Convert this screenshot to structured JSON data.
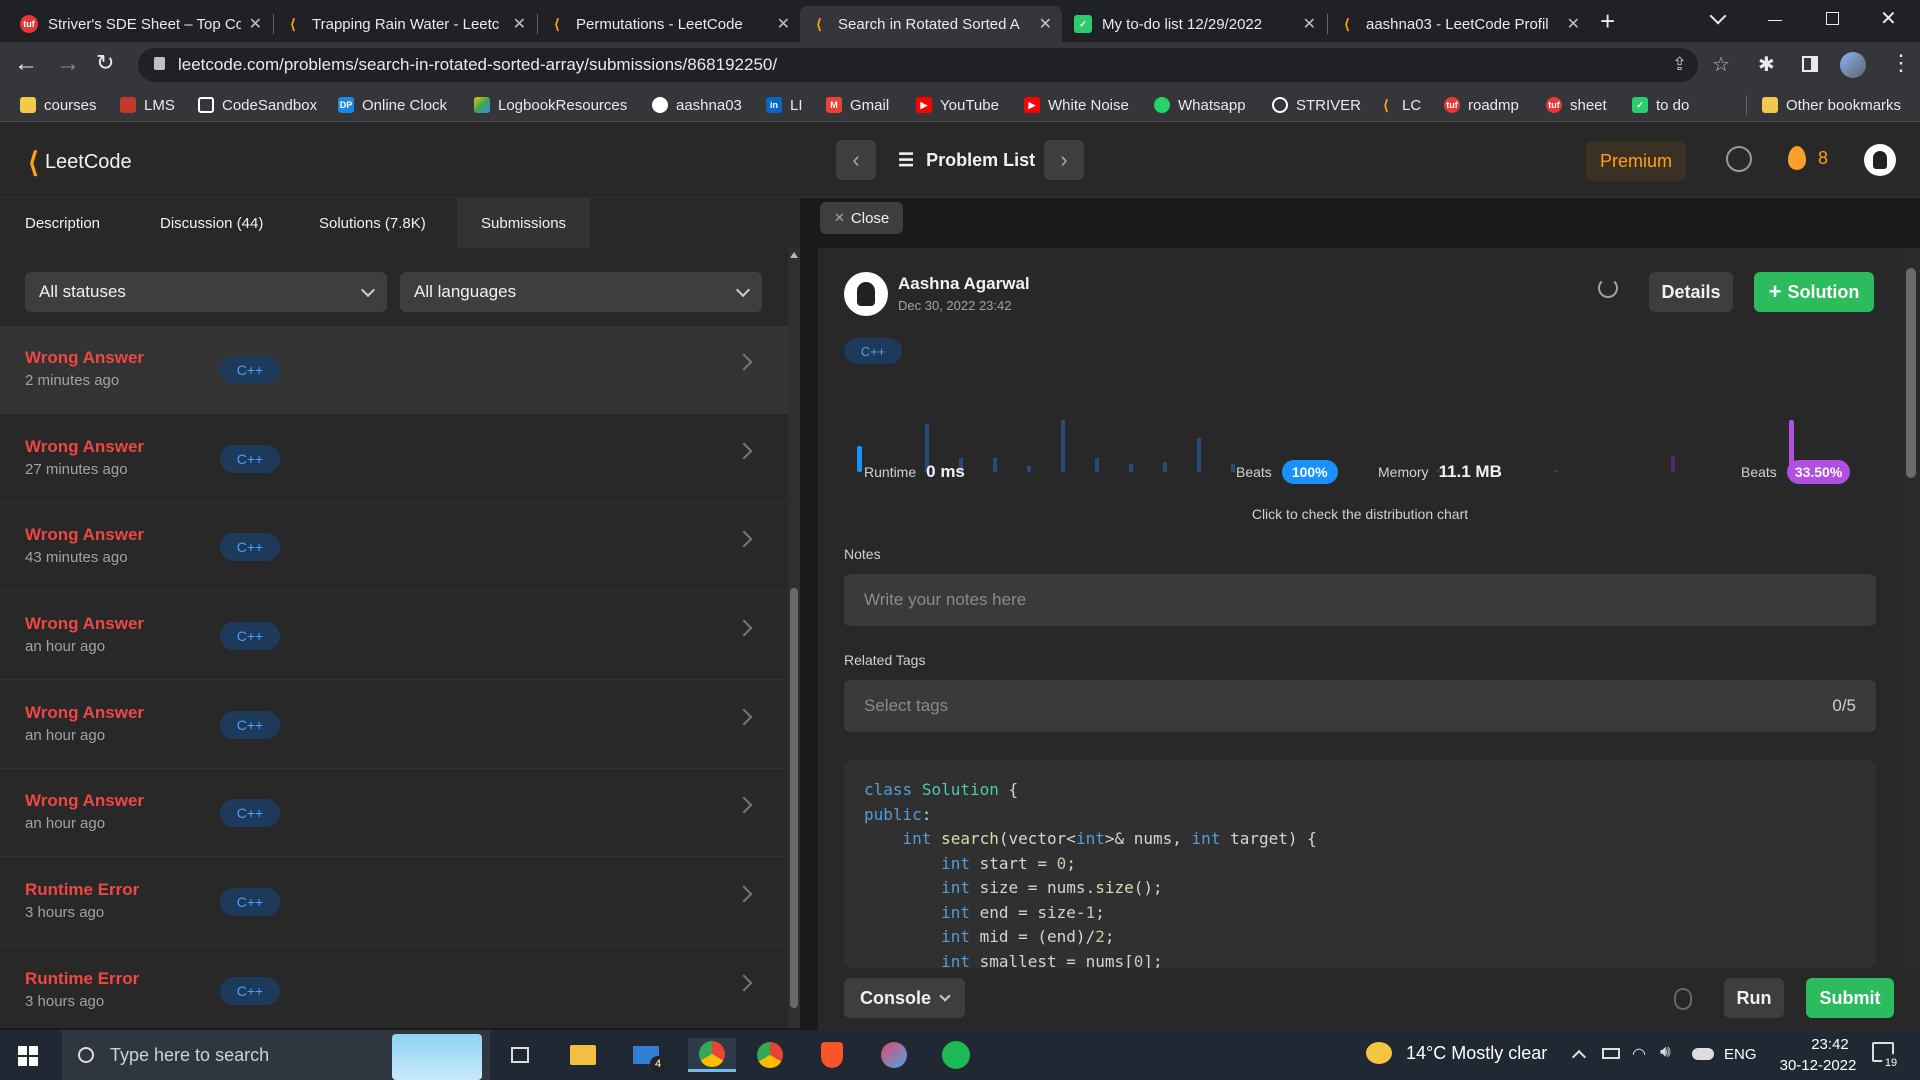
{
  "browser": {
    "tabs": [
      {
        "title": "Striver's SDE Sheet – Top Co",
        "favicon": "tuf-icon",
        "active": false
      },
      {
        "title": "Trapping Rain Water - Leetc",
        "favicon": "leetcode-icon",
        "active": false
      },
      {
        "title": "Permutations - LeetCode",
        "favicon": "leetcode-icon",
        "active": false
      },
      {
        "title": "Search in Rotated Sorted A",
        "favicon": "leetcode-icon",
        "active": true
      },
      {
        "title": "My to-do list 12/29/2022",
        "favicon": "todo-check-icon",
        "active": false
      },
      {
        "title": "aashna03 - LeetCode Profil",
        "favicon": "leetcode-icon",
        "active": false
      }
    ],
    "new_tab": "+",
    "url": "leetcode.com/problems/search-in-rotated-sorted-array/submissions/868192250/",
    "bookmarks": [
      {
        "label": "courses",
        "icon": "folder-icon",
        "color": "#f2c94c"
      },
      {
        "label": "LMS",
        "icon": "lms-icon",
        "color": "#c0392b"
      },
      {
        "label": "CodeSandbox",
        "icon": "codesandbox-icon",
        "color": "#ffffff"
      },
      {
        "label": "Online Clock",
        "icon": "dp-icon",
        "color": "#1e88e5"
      },
      {
        "label": "LogbookResources",
        "icon": "drive-icon",
        "color": "#34a853"
      },
      {
        "label": "aashna03",
        "icon": "github-icon",
        "color": "#ffffff"
      },
      {
        "label": "LI",
        "icon": "linkedin-icon",
        "color": "#0a66c2"
      },
      {
        "label": "Gmail",
        "icon": "gmail-icon",
        "color": "#ea4335"
      },
      {
        "label": "YouTube",
        "icon": "youtube-icon",
        "color": "#ff0000"
      },
      {
        "label": "White Noise",
        "icon": "youtube-icon",
        "color": "#ff0000"
      },
      {
        "label": "Whatsapp",
        "icon": "whatsapp-icon",
        "color": "#25d366"
      },
      {
        "label": "STRIVER",
        "icon": "globe-icon",
        "color": "#ffffff"
      },
      {
        "label": "LC",
        "icon": "leetcode-icon",
        "color": "#ffa116"
      },
      {
        "label": "roadmp",
        "icon": "tuf-icon",
        "color": "#e53935"
      },
      {
        "label": "sheet",
        "icon": "tuf-icon",
        "color": "#e53935"
      },
      {
        "label": "to do",
        "icon": "check-icon",
        "color": "#2ecc71"
      }
    ],
    "other_bookmarks": "Other bookmarks"
  },
  "header": {
    "logo_text": "LeetCode",
    "problem_list": "Problem List",
    "premium": "Premium",
    "streak": "8"
  },
  "left": {
    "tabs": [
      "Description",
      "Discussion (44)",
      "Solutions (7.8K)",
      "Submissions"
    ],
    "filter_status": "All statuses",
    "filter_language": "All languages",
    "submissions": [
      {
        "status": "Wrong Answer",
        "time": "2 minutes ago",
        "lang": "C++"
      },
      {
        "status": "Wrong Answer",
        "time": "27 minutes ago",
        "lang": "C++"
      },
      {
        "status": "Wrong Answer",
        "time": "43 minutes ago",
        "lang": "C++"
      },
      {
        "status": "Wrong Answer",
        "time": "an hour ago",
        "lang": "C++"
      },
      {
        "status": "Wrong Answer",
        "time": "an hour ago",
        "lang": "C++"
      },
      {
        "status": "Wrong Answer",
        "time": "an hour ago",
        "lang": "C++"
      },
      {
        "status": "Runtime Error",
        "time": "3 hours ago",
        "lang": "C++"
      },
      {
        "status": "Runtime Error",
        "time": "3 hours ago",
        "lang": "C++"
      }
    ]
  },
  "right": {
    "close": "Close",
    "user": "Aashna Agarwal",
    "date": "Dec 30, 2022 23:42",
    "details": "Details",
    "solution": "Solution",
    "lang": "C++",
    "runtime_label": "Runtime",
    "runtime_value": "0 ms",
    "beats_label": "Beats",
    "runtime_beats": "100%",
    "memory_label": "Memory",
    "memory_value": "11.1 MB",
    "memory_beats": "33.50%",
    "distribution_hint": "Click to check the distribution chart",
    "notes_label": "Notes",
    "notes_placeholder": "Write your notes here",
    "tags_label": "Related Tags",
    "tags_placeholder": "Select tags",
    "tags_count": "0/5",
    "code_lines": [
      "class Solution {",
      "public:",
      "    int search(vector<int>& nums, int target) {",
      "        int start = 0;",
      "        int size = nums.size();",
      "        int end = size-1;",
      "        int mid = (end)/2;",
      "        int smallest = nums[0];"
    ],
    "console": "Console",
    "run": "Run",
    "submit": "Submit"
  },
  "taskbar": {
    "search_placeholder": "Type here to search",
    "mail_badge": "4",
    "weather": "14°C  Mostly clear",
    "lang": "ENG",
    "time": "23:42",
    "date": "30-12-2022",
    "notif_count": "19"
  }
}
